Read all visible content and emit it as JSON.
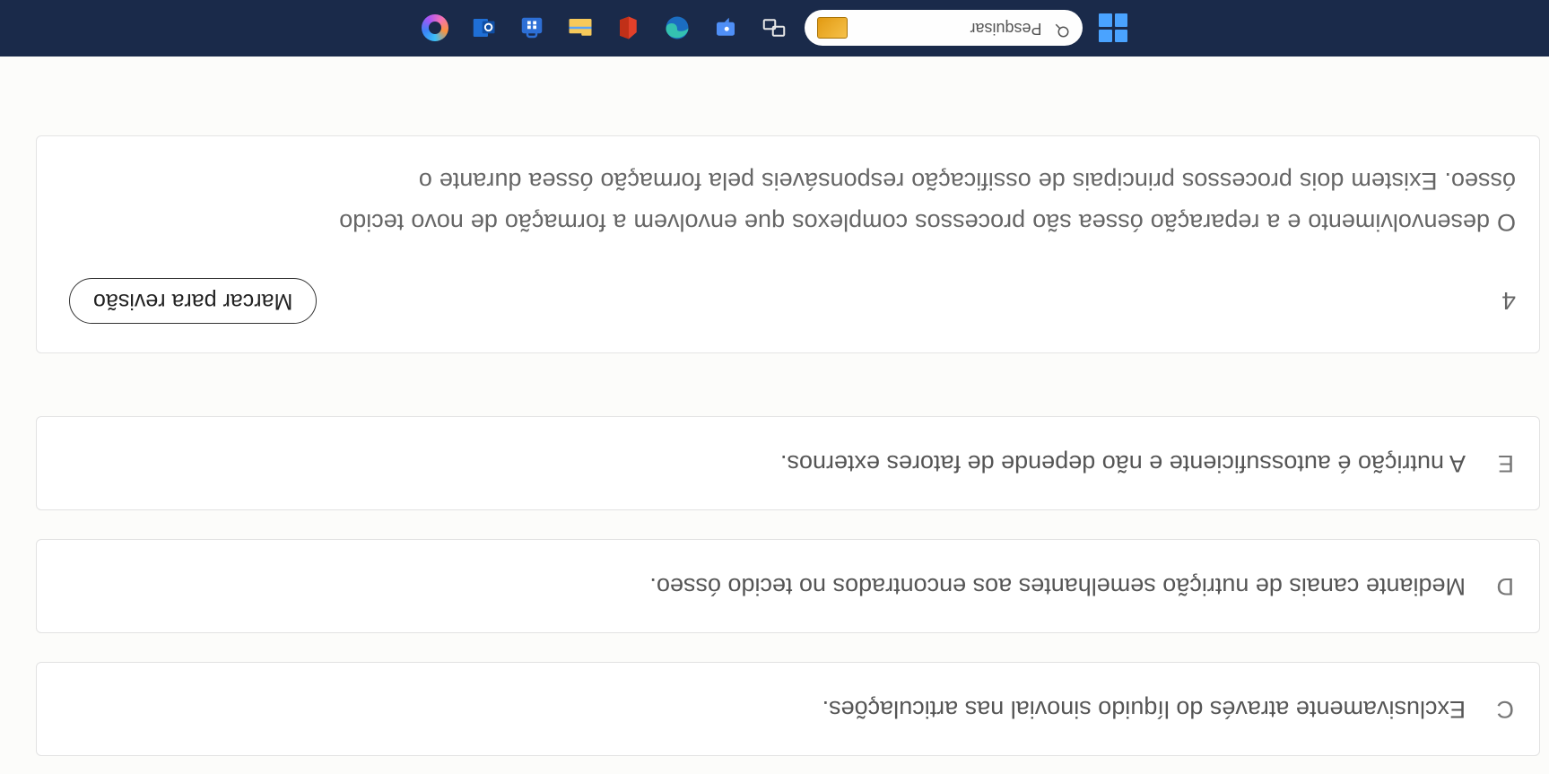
{
  "options": {
    "c": {
      "letter": "C",
      "text": "Exclusivamente através do líquido sinovial nas articulações."
    },
    "d": {
      "letter": "D",
      "text": "Mediante canais de nutrição semelhantes aos encontrados no tecido ósseo."
    },
    "e": {
      "letter": "E",
      "text": "A nutrição é autossuficiente e não depende de fatores externos."
    }
  },
  "question": {
    "number": "4",
    "mark_label": "Marcar para revisão",
    "text_line1": "O desenvolvimento e a reparação óssea são processos complexos que envolvem a formação de novo tecido",
    "text_line2": "ósseo. Existem dois processos principais de ossificação responsáveis pela formação óssea durante o"
  },
  "taskbar": {
    "search_placeholder": "Pesquisar"
  }
}
